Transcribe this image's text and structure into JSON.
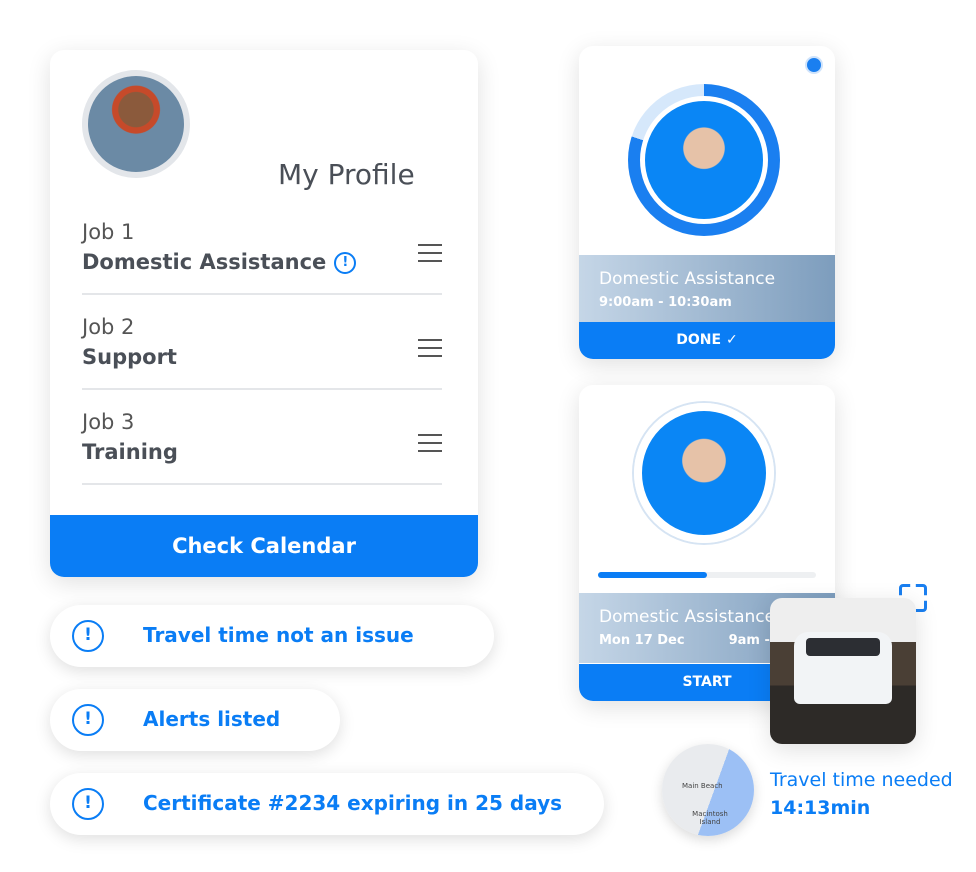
{
  "profile": {
    "title": "My Profile",
    "jobs": [
      {
        "number": "Job 1",
        "title": "Domestic Assistance"
      },
      {
        "number": "Job 2",
        "title": "Support"
      },
      {
        "number": "Job 3",
        "title": "Training"
      }
    ],
    "calendar_button": "Check Calendar"
  },
  "alerts": [
    "Travel time not an issue",
    "Alerts listed",
    "Certificate  #2234 expiring in 25 days"
  ],
  "appointment1": {
    "service": "Domestic Assistance",
    "time": "9:00am - 10:30am",
    "button": "DONE",
    "progress": 0.8
  },
  "appointment2": {
    "service": "Domestic Assistance",
    "date": "Mon 17  Dec",
    "time": "9am - 1",
    "button": "START",
    "progress": 0.5
  },
  "travel": {
    "label": "Travel time needed",
    "value": "14:13min",
    "map_labels": [
      "Main Beach",
      "Macintosh Island"
    ]
  },
  "colors": {
    "accent": "#0a7df5"
  }
}
